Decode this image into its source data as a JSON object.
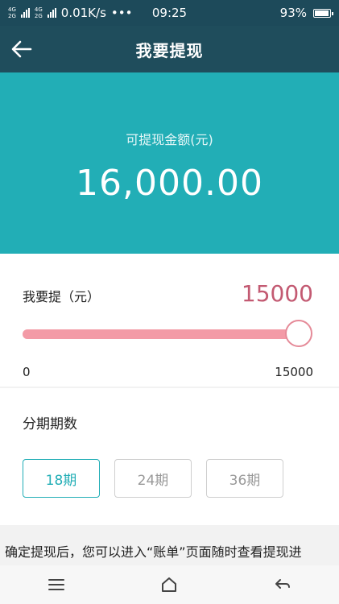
{
  "status_bar": {
    "network_types": [
      "4G",
      "4G",
      "2G"
    ],
    "secondary_network": "2G",
    "speed": "0.01K/s",
    "more": "•••",
    "time": "09:25",
    "battery_percent": "93%",
    "battery_level": 0.93
  },
  "header": {
    "title": "我要提现",
    "back_icon": "arrow-left-icon"
  },
  "hero": {
    "label": "可提现金额(元)",
    "amount": "16,000.00",
    "background": "#22aeb6"
  },
  "withdraw": {
    "label": "我要提（元）",
    "value": "15000",
    "slider": {
      "min": "0",
      "max": "15000",
      "level": 1.0
    },
    "accent": "#c35a72",
    "fill_color": "#f39aa6"
  },
  "installment": {
    "label": "分期期数",
    "options": [
      {
        "label": "18期",
        "selected": true
      },
      {
        "label": "24期",
        "selected": false
      },
      {
        "label": "36期",
        "selected": false
      }
    ],
    "selected_color": "#22aeb6"
  },
  "notice": {
    "text": "确定提现后，您可以进入“账单”页面随时查看提现进"
  },
  "system_nav": {
    "icons": [
      "menu-icon",
      "home-icon",
      "back-icon"
    ]
  }
}
